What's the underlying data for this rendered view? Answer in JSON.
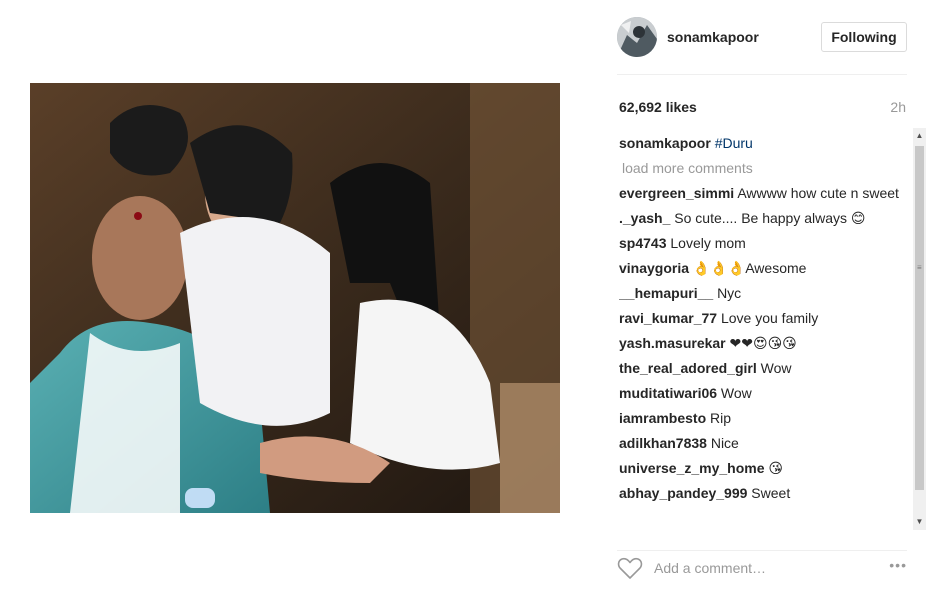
{
  "post": {
    "username": "sonamkapoor",
    "follow_label": "Following",
    "likes": "62,692 likes",
    "time": "2h",
    "caption_user": "sonamkapoor",
    "caption_tag": "#Duru",
    "load_more": "load more comments",
    "comments": [
      {
        "user": "evergreen_simmi",
        "text": "Awwww how cute n sweet"
      },
      {
        "user": "._yash_",
        "text": "So cute.... Be happy always 😊"
      },
      {
        "user": "sp4743",
        "text": "Lovely mom"
      },
      {
        "user": "vinaygoria",
        "text": "👌👌👌Awesome"
      },
      {
        "user": "__hemapuri__",
        "text": "Nyc"
      },
      {
        "user": "ravi_kumar_77",
        "text": "Love you family"
      },
      {
        "user": "yash.masurekar",
        "text": "❤❤😍😘😘"
      },
      {
        "user": "the_real_adored_girl",
        "text": "Wow"
      },
      {
        "user": "muditatiwari06",
        "text": "Wow"
      },
      {
        "user": "iamrambesto",
        "text": "Rip"
      },
      {
        "user": "adilkhan7838",
        "text": "Nice"
      },
      {
        "user": "universe_z_my_home",
        "text": "😘"
      },
      {
        "user": "abhay_pandey_999",
        "text": "Sweet"
      }
    ],
    "comment_placeholder": "Add a comment…",
    "more_label": "•••"
  },
  "icons": {
    "heart": "heart-outline-icon",
    "more": "more-options-icon"
  },
  "colors": {
    "hashtag": "#003569",
    "muted": "#999999",
    "border": "#dbdbdb"
  }
}
